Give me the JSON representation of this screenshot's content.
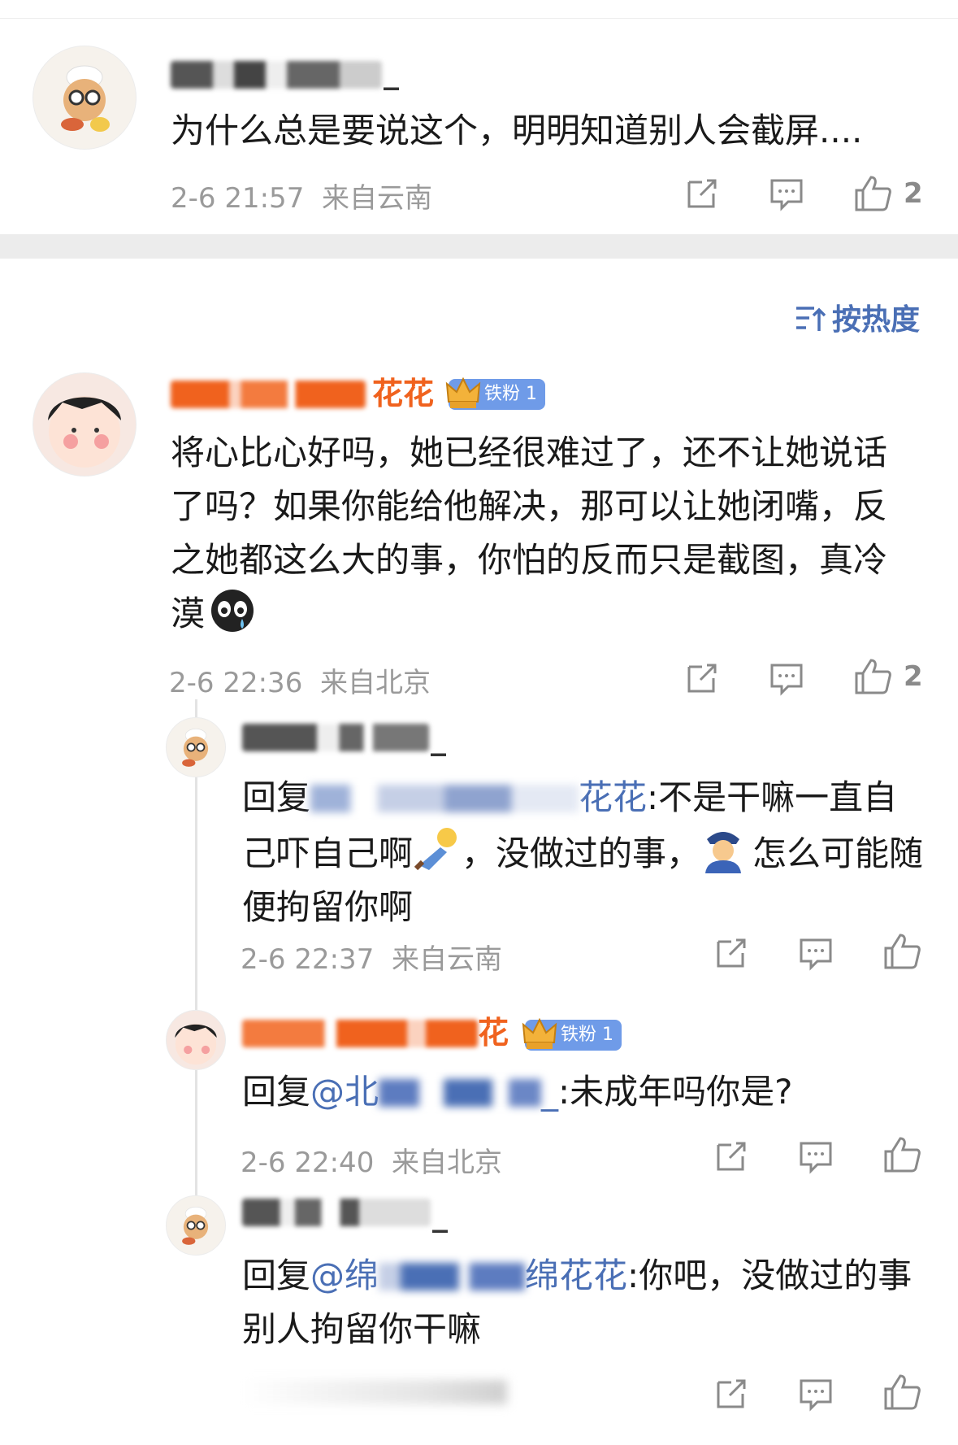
{
  "comments": [
    {
      "id": "c1",
      "user_tail": "_",
      "text": "为什么总是要说这个，明明知道别人会截屏....",
      "time": "2-6 21:57",
      "location": "来自云南",
      "likes": "2"
    }
  ],
  "sort": {
    "label": "按热度",
    "icon": "sort-icon"
  },
  "main_comment": {
    "user_tail": "花花",
    "badge": "铁粉 1",
    "text": "将心比心好吗，她已经很难过了，还不让她说话了吗？如果你能给他解决，那可以让她闭嘴，反之她都这么大的事，你怕的反而只是截图，真冷漠",
    "emoji": "crying-face-emoji",
    "time": "2-6 22:36",
    "location": "来自北京",
    "likes": "2"
  },
  "replies": [
    {
      "user_tail": "_",
      "prefix": "回复",
      "mention_tail": "花花",
      "text_a": ":不是干嘛一直自己吓自己啊",
      "text_b": "，没做过的事，",
      "text_c": "怎么可能随便拘留你啊",
      "emojis": [
        "fainting-person-emoji",
        "police-officer-emoji"
      ],
      "time": "2-6 22:37",
      "location": "来自云南"
    },
    {
      "user_tail": "花",
      "badge": "铁粉 1",
      "prefix": "回复",
      "mention_head": "@北",
      "mention_tail": "_",
      "text": ":未成年吗你是?",
      "time": "2-6 22:40",
      "location": "来自北京"
    },
    {
      "user_tail": "_",
      "prefix": "回复",
      "mention_head": "@绵",
      "mention_tail": "绵花花",
      "text": ":你吧，没做过的事别人拘留你干嘛"
    }
  ],
  "colors": {
    "accent": "#4a6fb5",
    "meta": "#9a9a9a",
    "name_orange": "#f0621e",
    "badge": "#6f9be8"
  }
}
